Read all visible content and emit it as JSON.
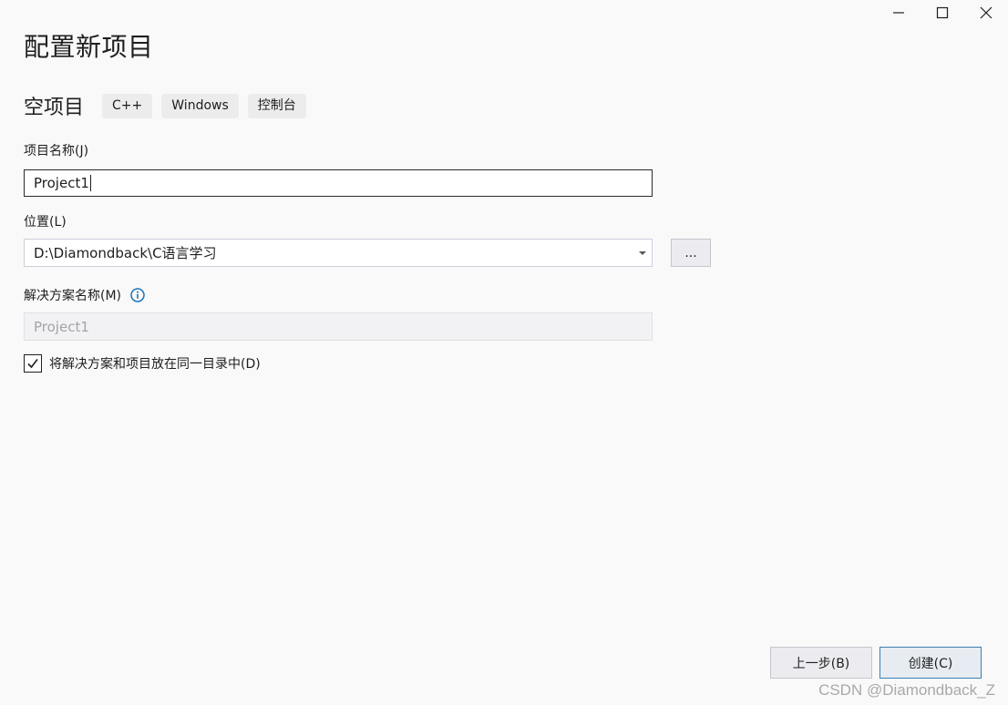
{
  "window": {
    "minimize_icon": "minimize-icon",
    "maximize_icon": "maximize-icon",
    "close_icon": "close-icon"
  },
  "page_title": "配置新项目",
  "template": {
    "name": "空项目",
    "tags": [
      "C++",
      "Windows",
      "控制台"
    ]
  },
  "project_name": {
    "label": "项目名称(J)",
    "value": "Project1"
  },
  "location": {
    "label": "位置(L)",
    "value": "D:\\Diamondback\\C语言学习",
    "browse_label": "..."
  },
  "solution_name": {
    "label": "解决方案名称(M)",
    "placeholder": "Project1",
    "info_icon": "info-icon"
  },
  "same_directory": {
    "label": "将解决方案和项目放在同一目录中(D)",
    "checked": true
  },
  "footer": {
    "back_label": "上一步(B)",
    "create_label": "创建(C)"
  },
  "watermark": "CSDN @Diamondback_Z",
  "colors": {
    "background": "#f9f9f9",
    "tag_background": "#ececec",
    "info_icon": "#1a74b8",
    "primary_border": "#3c7fb1"
  }
}
